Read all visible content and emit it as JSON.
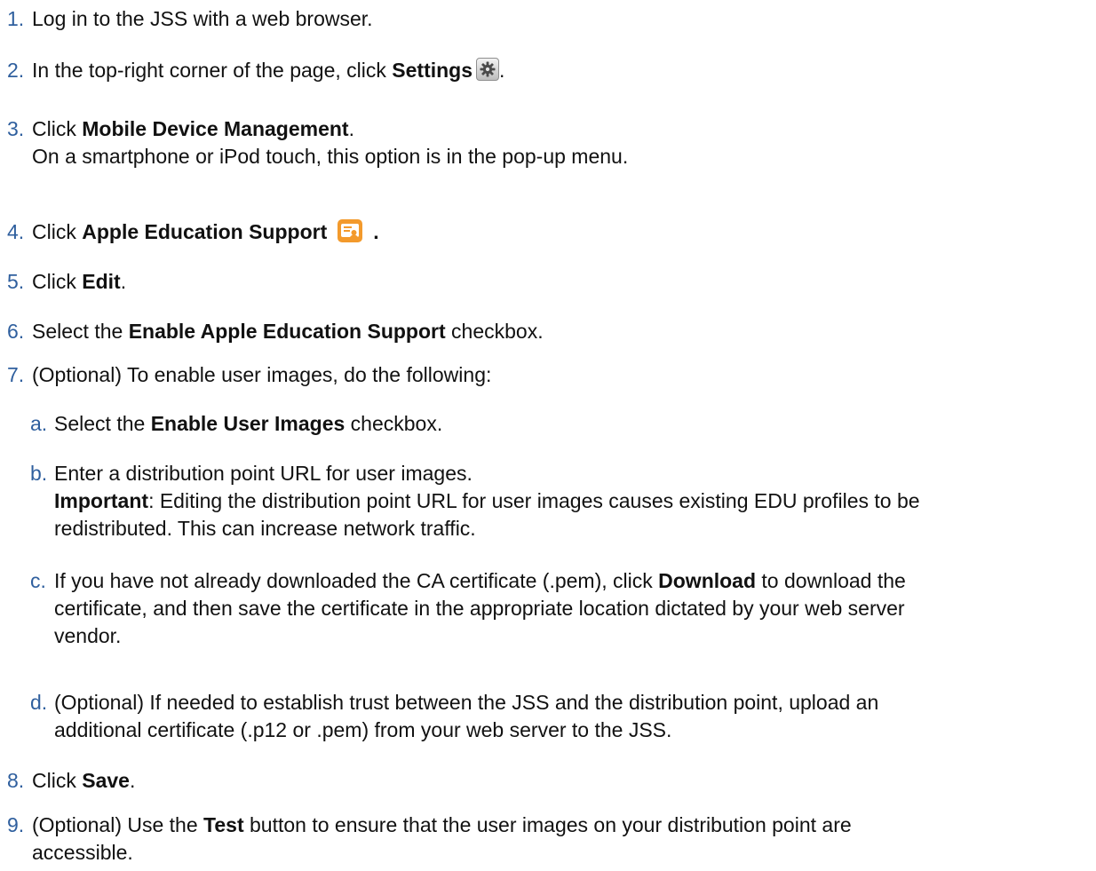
{
  "steps": [
    {
      "num": "1.",
      "text": "Log in to the JSS with a web browser."
    },
    {
      "num": "2.",
      "pre": "In the top-right corner of the page, click ",
      "bold": "Settings",
      "post": "."
    },
    {
      "num": "3.",
      "pre": "Click ",
      "bold": "Mobile Device Management",
      "post": ".",
      "line2": "On a smartphone or iPod touch, this option is in the pop-up menu."
    },
    {
      "num": "4.",
      "pre": "Click ",
      "bold": "Apple Education Support",
      "post": "."
    },
    {
      "num": "5.",
      "pre": "Click ",
      "bold": "Edit",
      "post": "."
    },
    {
      "num": "6.",
      "pre": "Select the ",
      "bold": "Enable Apple Education Support",
      "post": " checkbox."
    },
    {
      "num": "7.",
      "text": "(Optional) To enable user images, do the following:"
    },
    {
      "num": "8.",
      "pre": "Click ",
      "bold": "Save",
      "post": "."
    },
    {
      "num": "9.",
      "pre": "(Optional) Use the ",
      "bold": "Test",
      "post": " button to ensure that the user images on your distribution point are",
      "line2": "accessible."
    }
  ],
  "substeps": [
    {
      "num": "a.",
      "pre": "Select the ",
      "bold": "Enable User Images",
      "post": " checkbox."
    },
    {
      "num": "b.",
      "text": "Enter a distribution point URL for user images.",
      "important_label": "Important",
      "important_text": ": Editing the distribution point URL for user images causes existing EDU profiles to be",
      "line3": "redistributed. This can increase network traffic."
    },
    {
      "num": "c.",
      "pre": "If you have not already downloaded the CA certificate (.pem), click ",
      "bold": "Download",
      "post": " to download the",
      "line2": "certificate, and then save the certificate in the appropriate location dictated by your web server",
      "line3": "vendor."
    },
    {
      "num": "d.",
      "text": "(Optional) If needed to establish trust between the JSS and the distribution point, upload an",
      "line2": "additional certificate (.p12 or .pem) from your web server to the JSS."
    }
  ],
  "icons": {
    "settings": "gear-icon",
    "apple_education_support": "apple-education-support-icon"
  },
  "colors": {
    "step_number": "#2f5f9e",
    "edu_icon": "#f39a2c"
  }
}
